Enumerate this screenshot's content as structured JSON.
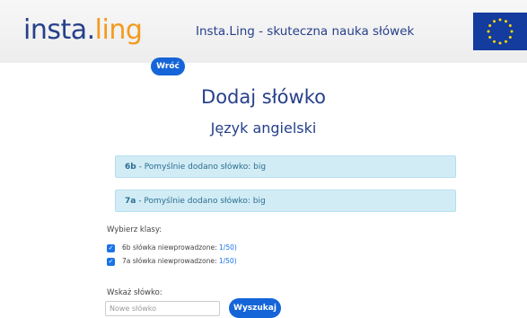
{
  "header": {
    "logo_part1": "insta.",
    "logo_part2": "ling",
    "tagline": "Insta.Ling - skuteczna nauka słówek"
  },
  "back_button": "Wróć",
  "page_title": "Dodaj słówko",
  "language_title": "Język angielski",
  "alerts": [
    {
      "class": "6b",
      "text": " - Pomyślnie dodano słówko: big"
    },
    {
      "class": "7a",
      "text": " - Pomyślnie dodano słówko: big"
    }
  ],
  "class_select": {
    "label": "Wybierz klasy:",
    "items": [
      {
        "text": "6b słówka niewprowadzone: ",
        "count": "1/50)",
        "checked": true
      },
      {
        "text": "7a słówka niewprowadzone: ",
        "count": "1/50)",
        "checked": true
      }
    ]
  },
  "search": {
    "label": "Wskaż słówko:",
    "placeholder": "Nowe słówko",
    "button": "Wyszukaj"
  },
  "colors": {
    "brand_blue": "#27408b",
    "brand_orange": "#f39a1e",
    "button_blue": "#1565d8",
    "alert_bg": "#d2ecf6"
  }
}
